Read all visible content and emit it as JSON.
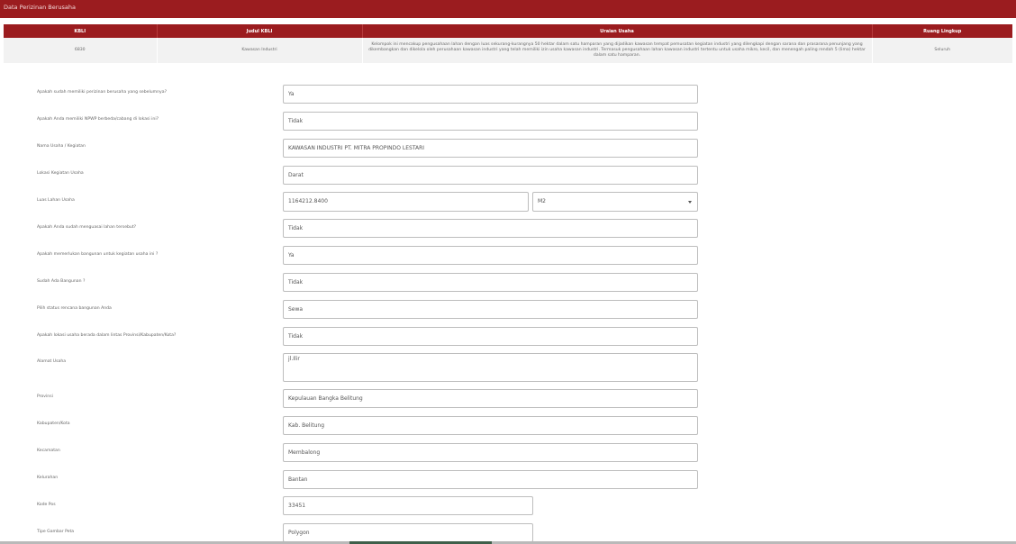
{
  "header": {
    "title": "Data Perizinan Berusaha"
  },
  "kbli_table": {
    "columns": [
      "KBLI",
      "Judul KBLI",
      "Uraian Usaha",
      "Ruang Lingkup"
    ],
    "rows": [
      {
        "kbli": "6830",
        "judul": "Kawasan Industri",
        "uraian": "Kelompok ini mencakup pengusahaan lahan dengan luas sekurang-kurangnya 50 hektar dalam satu hamparan yang dijadikan kawasan tempat pemusatan kegiatan industri yang dilengkapi dengan sarana dan prasarana penunjang yang dikembangkan dan dikelola oleh perusahaan kawasan industri yang telah memiliki izin usaha kawasan industri. Termasuk pengusahaan lahan kawasan industri tertentu untuk usaha mikro, kecil, dan menengah paling rendah 5 (lima) hektar dalam satu hamparan.",
        "ruang_lingkup": "Seluruh"
      }
    ]
  },
  "form": {
    "q_perizinan_sebelumnya": {
      "label": "Apakah sudah memiliki perizinan berusaha yang sebelumnya?",
      "value": "Ya"
    },
    "q_npwp_cabang": {
      "label": "Apakah Anda memiliki NPWP berbeda/cabang di lokasi ini?",
      "value": "Tidak"
    },
    "nama_usaha": {
      "label": "Nama Usaha / Kegiatan",
      "value": "KAWASAN INDUSTRI PT. MITRA PROPINDO LESTARI"
    },
    "lokasi_kegiatan": {
      "label": "Lokasi Kegiatan Usaha",
      "value": "Darat"
    },
    "luas_lahan": {
      "label": "Luas Lahan Usaha",
      "value": "1164212.8400",
      "unit": "M2"
    },
    "q_menguasai_lahan": {
      "label": "Apakah Anda sudah menguasai lahan tersebut?",
      "value": "Tidak"
    },
    "q_memerlukan_bangunan": {
      "label": "Apakah memerlukan bangunan untuk kegiatan usaha ini ?",
      "value": "Ya"
    },
    "q_sudah_ada_bangunan": {
      "label": "Sudah Ada Bangunan ?",
      "value": "Tidak"
    },
    "status_bangunan": {
      "label": "Pilih status rencana bangunan Anda",
      "value": "Sewa"
    },
    "q_lintas_wilayah": {
      "label": "Apakah lokasi usaha berada dalam lintas Provinsi/Kabupaten/Kota?",
      "value": "Tidak"
    },
    "alamat": {
      "label": "Alamat Usaha",
      "value": "jl.Ilir"
    },
    "provinsi": {
      "label": "Provinsi",
      "value": "Kepulauan Bangka Belitung"
    },
    "kabupaten": {
      "label": "Kabupaten/Kota",
      "value": "Kab. Belitung"
    },
    "kecamatan": {
      "label": "Kecamatan",
      "value": "Membalong"
    },
    "kelurahan": {
      "label": "Kelurahan",
      "value": "Bantan"
    },
    "kode_pos": {
      "label": "Kode Pos",
      "value": "33451"
    },
    "tipe_gambar_peta": {
      "label": "Tipe Gambar Peta",
      "value": "Polygon"
    }
  },
  "colors": {
    "primary": "#9b1c1f",
    "row_bg": "#f2f2f2",
    "border": "#bdbdbd"
  },
  "icons": {
    "select_caret": "caret-down-icon"
  }
}
